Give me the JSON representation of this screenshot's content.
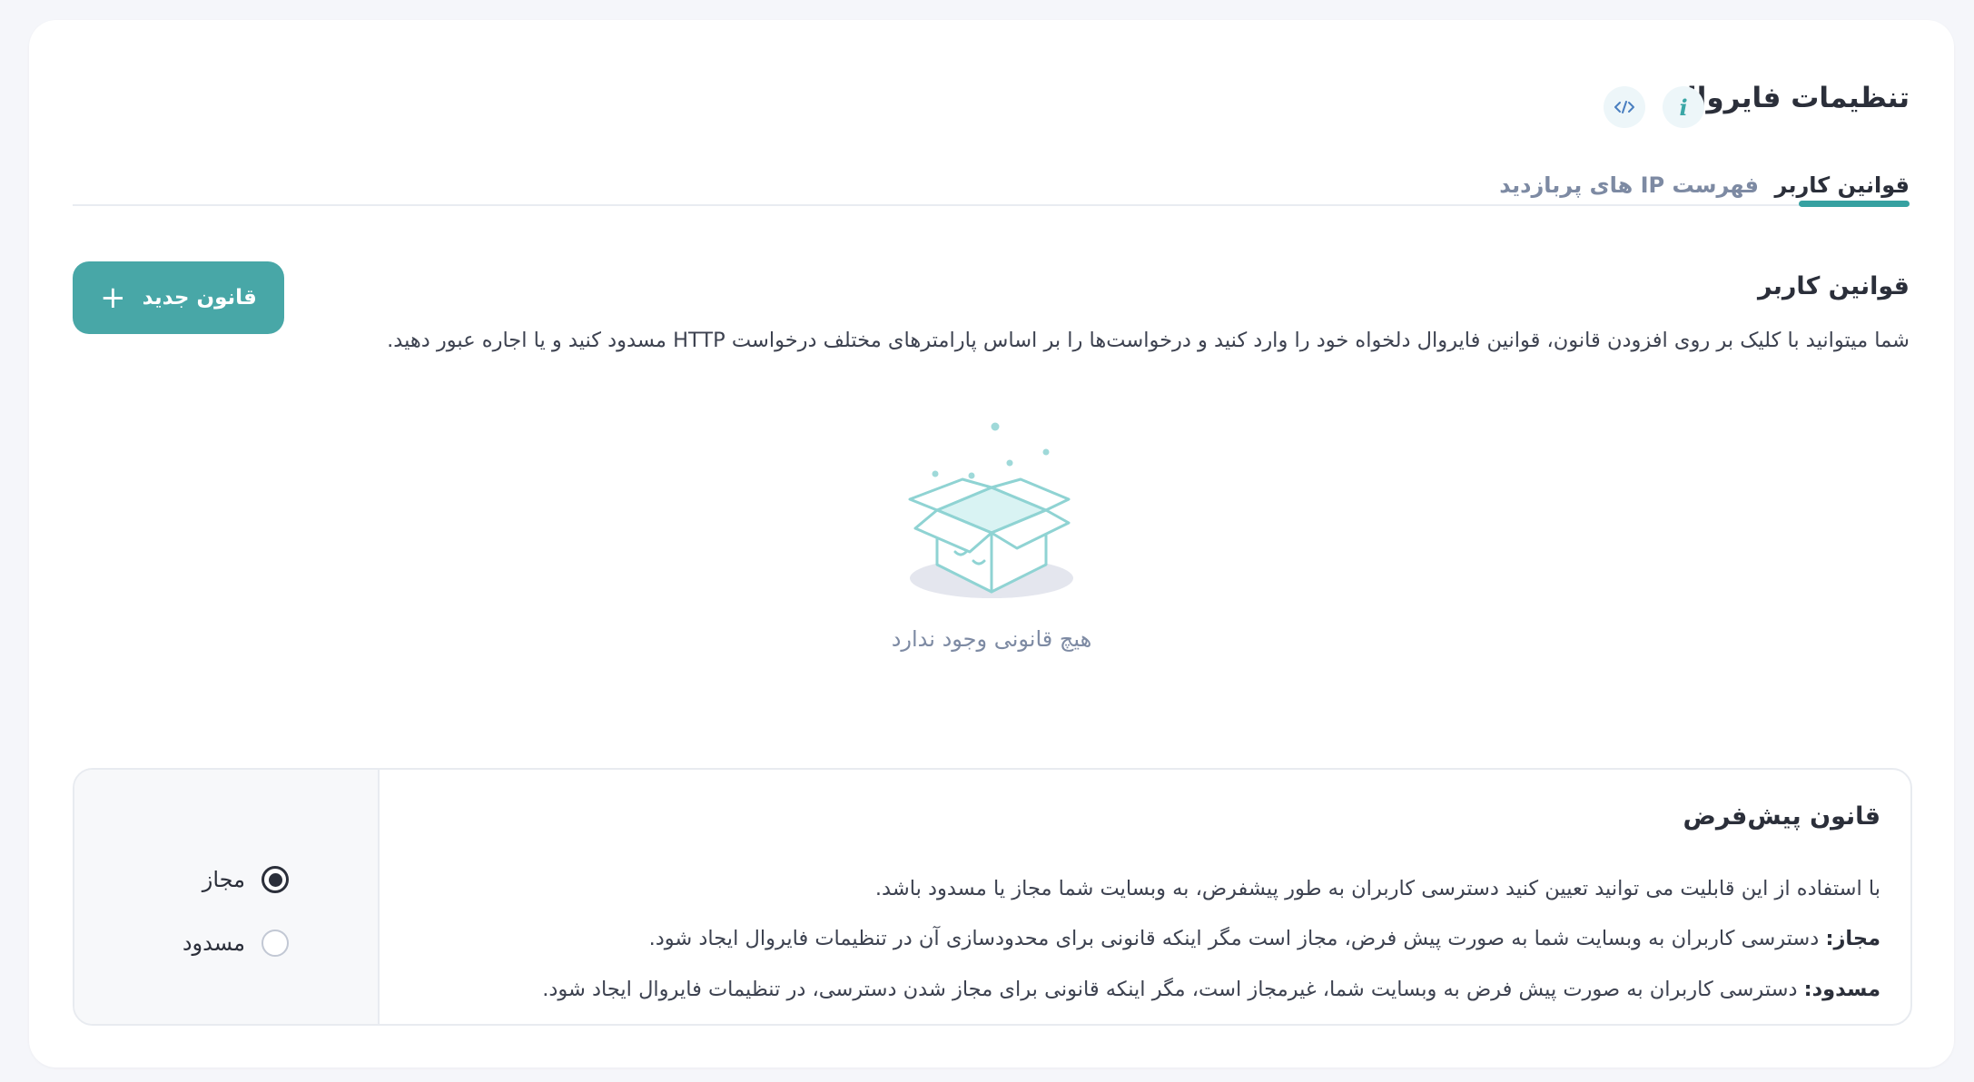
{
  "header": {
    "title": "تنظیمات فایروال",
    "info_icon": "info-icon",
    "code_icon": "code-icon"
  },
  "tabs": [
    {
      "label": "قوانین کاربر",
      "active": true
    },
    {
      "label": "فهرست IP های پربازدید",
      "active": false
    }
  ],
  "section": {
    "title": "قوانین کاربر",
    "description": "شما میتوانید با کلیک بر روی افزودن قانون، قوانین فایروال دلخواه خود را وارد کنید و درخواست‌ها را بر اساس پارامترهای مختلف درخواست HTTP مسدود کنید و یا اجاره عبور دهید.",
    "new_button": "قانون جدید",
    "new_button_icon": "plus-icon"
  },
  "empty": {
    "text": "هیچ قانونی وجود ندارد",
    "illustration": "open-box-icon"
  },
  "default_rule": {
    "title": "قانون پیش‌فرض",
    "line1": "با استفاده از این قابلیت می توانید تعیین کنید دسترسی کاربران به طور پیشفرض، به وبسایت شما مجاز یا مسدود باشد.",
    "line2_label": "مجاز:",
    "line2_text": " دسترسی کاربران به وبسایت شما به صورت پیش فرض، مجاز است مگر اینکه قانونی برای محدودسازی آن در تنظیمات فایروال ایجاد شود.",
    "line3_label": "مسدود:",
    "line3_text": " دسترسی کاربران به صورت پیش فرض به وبسایت شما، غیرمجاز است، مگر اینکه قانونی برای مجاز شدن دسترسی، در تنظیمات فایروال ایجاد شود.",
    "options": [
      {
        "label": "مجاز",
        "selected": true
      },
      {
        "label": "مسدود",
        "selected": false
      }
    ]
  },
  "colors": {
    "accent": "#36a1a1",
    "button": "#48a7a7",
    "muted_text": "#7d8aa3"
  }
}
